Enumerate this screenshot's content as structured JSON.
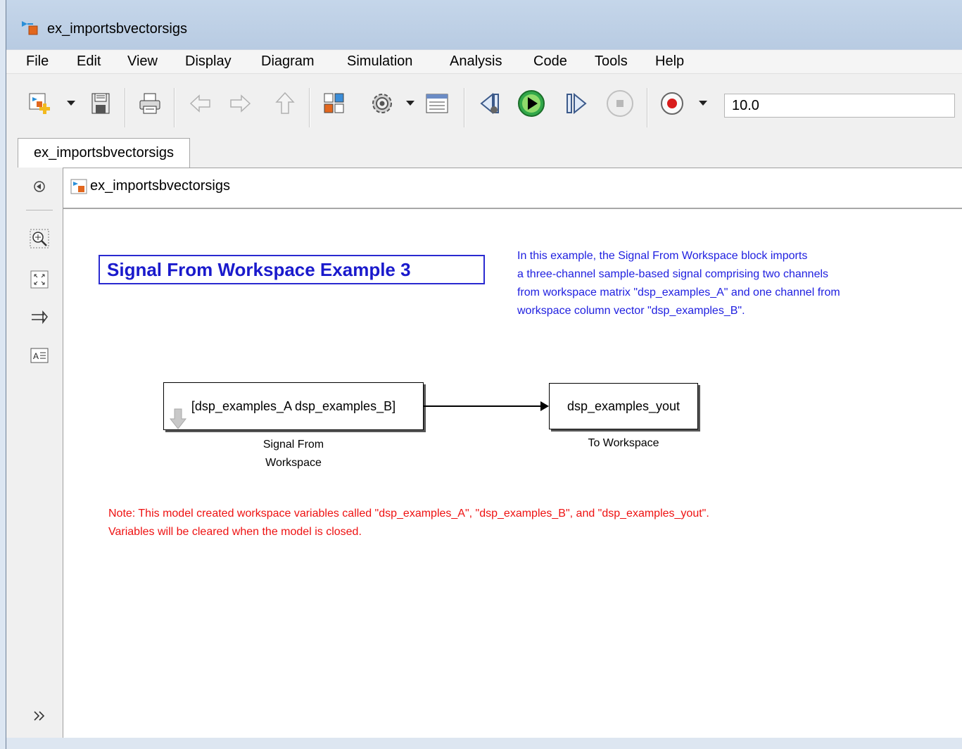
{
  "window": {
    "title": "ex_importsbvectorsigs"
  },
  "menu": {
    "items": [
      "File",
      "Edit",
      "View",
      "Display",
      "Diagram",
      "Simulation",
      "Analysis",
      "Code",
      "Tools",
      "Help"
    ]
  },
  "toolbar": {
    "icons": [
      "new-model-icon",
      "save-icon",
      "print-icon",
      "back-icon",
      "forward-icon",
      "up-icon",
      "library-browser-icon",
      "model-settings-icon",
      "model-explorer-icon",
      "step-back-icon",
      "run-icon",
      "step-forward-icon",
      "stop-icon",
      "record-icon"
    ],
    "stop_time": "10.0"
  },
  "tabs": [
    "ex_importsbvectorsigs"
  ],
  "address": {
    "path": "ex_importsbvectorsigs"
  },
  "palette": {
    "icons": [
      "hide-browser-icon",
      "zoom-icon",
      "fit-to-view-icon",
      "arrow-route-icon",
      "annotation-icon",
      "expand-icon"
    ]
  },
  "diagram": {
    "title": "Signal From Workspace Example 3",
    "description": [
      "In this example, the Signal From Workspace block imports",
      "a three-channel sample-based signal comprising two channels",
      "from workspace matrix \"dsp_examples_A\" and one channel from",
      "workspace column vector \"dsp_examples_B\"."
    ],
    "note": [
      "Note: This model created workspace variables called \"dsp_examples_A\", \"dsp_examples_B\", and \"dsp_examples_yout\".",
      "Variables will be cleared when the model is closed."
    ],
    "blocks": [
      {
        "content": "[dsp_examples_A dsp_examples_B]",
        "label_lines": [
          "Signal From",
          "Workspace"
        ]
      },
      {
        "content": "dsp_examples_yout",
        "label_lines": [
          "To Workspace"
        ]
      }
    ],
    "title_color": "#1a1acc",
    "description_color": "#2020e0",
    "note_color": "#ee1111"
  }
}
